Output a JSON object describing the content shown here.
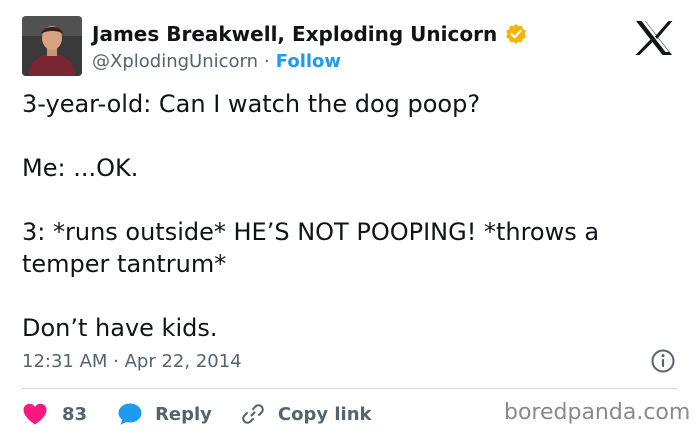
{
  "author": {
    "display_name": "James Breakwell, Exploding Unicorn",
    "handle": "@XplodingUnicorn",
    "separator": "·",
    "follow_label": "Follow",
    "verified_icon": "verified-badge-icon",
    "verified_color": "#f4b400"
  },
  "tweet": {
    "text": "3-year-old: Can I watch the dog poop?\n\nMe: ...OK.\n\n3: *runs outside* HE’S NOT POOPING! *throws a temper tantrum*\n\nDon’t have kids.",
    "timestamp": "12:31 AM · Apr 22, 2014"
  },
  "actions": {
    "like_count": "83",
    "reply_label": "Reply",
    "copy_link_label": "Copy link"
  },
  "watermark": "boredpanda.com",
  "colors": {
    "accent": "#1d9bf0",
    "like": "#f91880",
    "secondary_text": "#536471"
  }
}
